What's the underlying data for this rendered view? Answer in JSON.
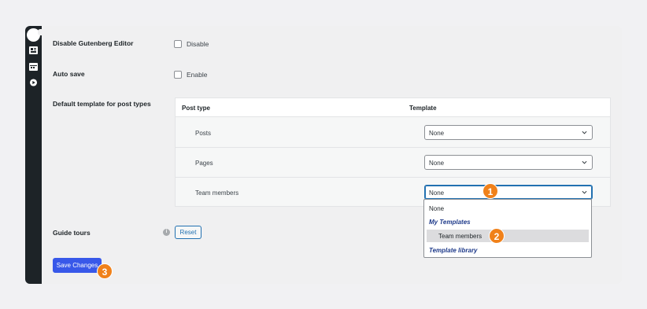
{
  "settings": {
    "gutenberg": {
      "label": "Disable Gutenberg Editor",
      "option": "Disable"
    },
    "autosave": {
      "label": "Auto save",
      "option": "Enable"
    },
    "default_template": {
      "label": "Default template for post types",
      "columns": [
        "Post type",
        "Template"
      ],
      "rows": [
        {
          "post_type": "Posts",
          "template": "None"
        },
        {
          "post_type": "Pages",
          "template": "None"
        },
        {
          "post_type": "Team members",
          "template": "None"
        }
      ]
    },
    "guide_tours": {
      "label": "Guide tours",
      "info_icon": "i",
      "reset_label": "Reset"
    },
    "save_label": "Save Changes"
  },
  "dropdown": {
    "option_none": "None",
    "group_my_templates": "My Templates",
    "option_team_members": "Team members",
    "group_template_library": "Template library"
  },
  "badges": [
    "1",
    "2",
    "3"
  ],
  "colors": {
    "accent": "#3858e9",
    "badge": "#f0811a",
    "adminbar": "#1d2327",
    "group_text": "#1e3a8a"
  }
}
